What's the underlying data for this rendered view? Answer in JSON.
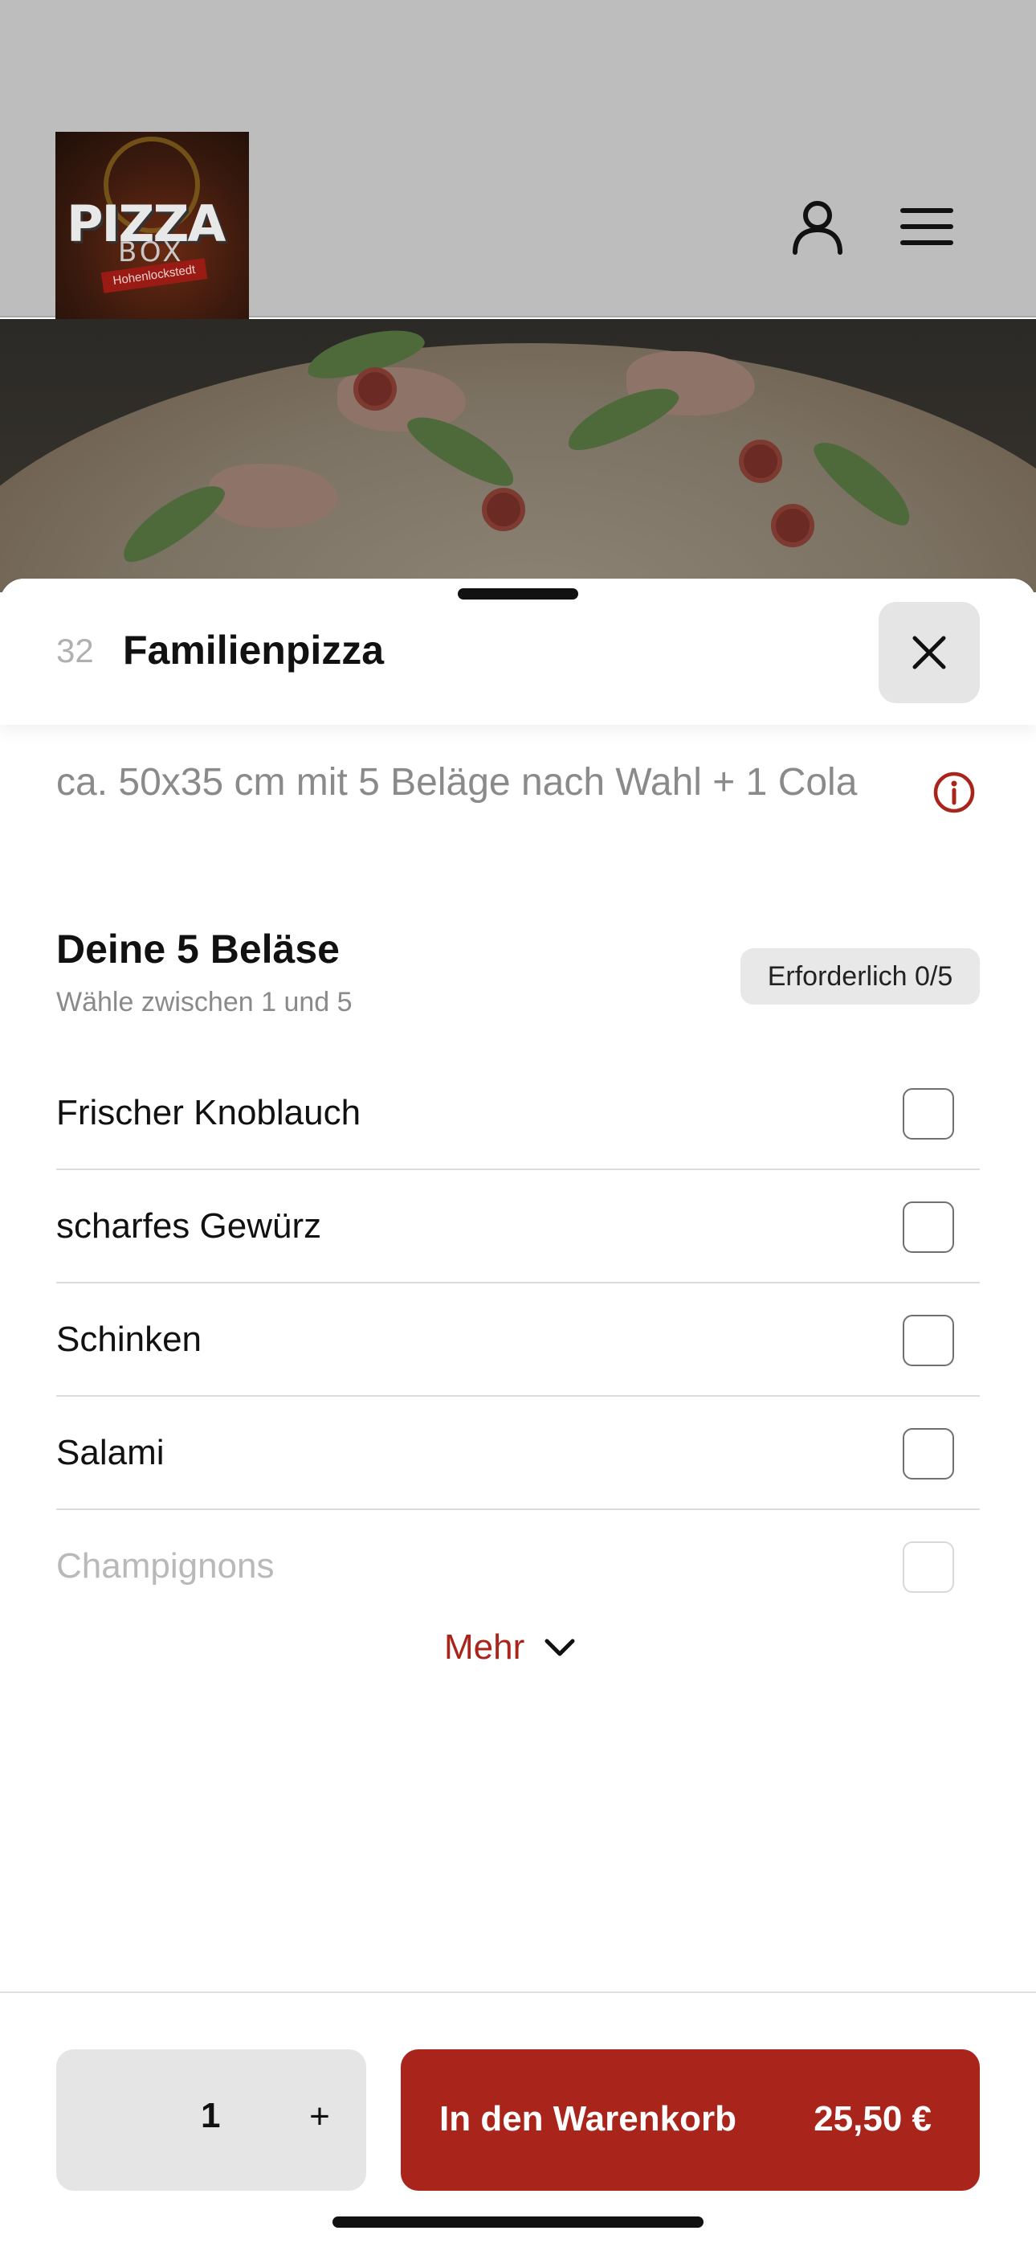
{
  "header": {
    "logo": {
      "text_main": "PIZZA",
      "text_sub": "BOX",
      "text_tag": "Hohenlockstedt"
    },
    "icons": [
      "user-icon",
      "menu-icon"
    ]
  },
  "item": {
    "number": "32",
    "title": "Familienpizza",
    "description": "ca. 50x35 cm mit 5 Beläge nach Wahl + 1 Cola"
  },
  "options_group": {
    "title": "Deine 5 Beläse",
    "subtitle": "Wähle zwischen 1 und 5",
    "badge": "Erforderlich 0/5",
    "items": [
      {
        "label": "Frischer Knoblauch",
        "checked": false
      },
      {
        "label": "scharfes Gewürz",
        "checked": false
      },
      {
        "label": "Schinken",
        "checked": false
      },
      {
        "label": "Salami",
        "checked": false
      },
      {
        "label": "Champignons",
        "checked": false
      }
    ],
    "more_label": "Mehr"
  },
  "footer": {
    "quantity": "1",
    "plus": "+",
    "cart_label": "In den Warenkorb",
    "price": "25,50 €"
  },
  "colors": {
    "accent": "#a9241b",
    "overlay": "#bdbdbd"
  }
}
